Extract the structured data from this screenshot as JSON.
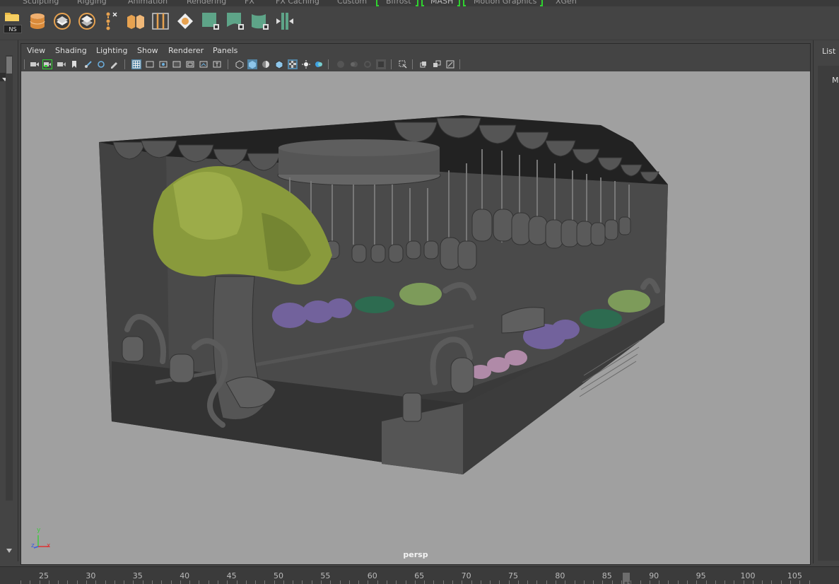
{
  "shelf_tabs": [
    "Sculpting",
    "Rigging",
    "Animation",
    "Rendering",
    "FX",
    "FX Caching",
    "Custom",
    "Bifrost",
    "MASH",
    "Motion Graphics",
    "XGen"
  ],
  "shelf": {
    "ns_label": "NS",
    "icons": [
      "folder-icon",
      "database-icon",
      "layer-icon",
      "layer-alt-icon",
      "joint-chain-icon",
      "cube-split-icon",
      "bracket-icon",
      "diamond-icon",
      "green-square-icon",
      "green-deform-icon",
      "green-wrap-icon",
      "mirror-icon"
    ]
  },
  "viewport_menu": [
    "View",
    "Shading",
    "Lighting",
    "Show",
    "Renderer",
    "Panels"
  ],
  "viewport": {
    "camera": "persp",
    "axis_labels": {
      "y": "y",
      "z": "z",
      "x": "x"
    }
  },
  "right_panel": {
    "tab": "List",
    "label": "M"
  },
  "timeline": {
    "ticks": [
      "25",
      "30",
      "35",
      "40",
      "45",
      "50",
      "55",
      "60",
      "65",
      "70",
      "75",
      "80",
      "85",
      "90",
      "95",
      "100",
      "105"
    ],
    "current_frame": "87"
  },
  "colors": {
    "ui_bg": "#444444",
    "viewport_bg": "#a0a0a0",
    "accent": "#5285a6",
    "highlight": "#2fd12f",
    "shelf_green": "#5ea488"
  }
}
